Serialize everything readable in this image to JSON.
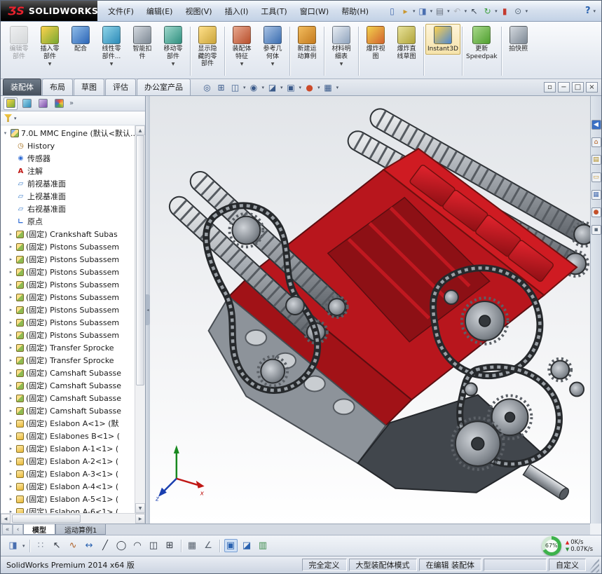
{
  "titlebar": {
    "logo_mark": "ƷS",
    "logo_text": "SOLIDWORKS",
    "menus": [
      "文件(F)",
      "编辑(E)",
      "视图(V)",
      "插入(I)",
      "工具(T)",
      "窗口(W)",
      "帮助(H)"
    ],
    "help_label": "?",
    "quick_icons": [
      {
        "name": "new-document-icon",
        "glyph": "▯",
        "color": "#4a6fb0"
      },
      {
        "name": "open-icon",
        "glyph": "▸",
        "color": "#c9972f",
        "caret": true
      },
      {
        "name": "save-icon",
        "glyph": "◨",
        "color": "#4a6fb0",
        "caret": true
      },
      {
        "name": "print-icon",
        "glyph": "▤",
        "color": "#6d7683",
        "caret": true
      },
      {
        "name": "undo-icon",
        "glyph": "↶",
        "color": "#6d7683",
        "caret": true,
        "disabled": true
      },
      {
        "name": "select-icon",
        "glyph": "↖",
        "color": "#3a4552"
      },
      {
        "name": "rebuild-icon",
        "glyph": "↻",
        "color": "#3da03d",
        "caret": true
      },
      {
        "name": "file-properties-icon",
        "glyph": "▮",
        "color": "#c43a2f"
      },
      {
        "name": "options-icon",
        "glyph": "⊙",
        "color": "#5a6a7a",
        "caret": true
      }
    ]
  },
  "ribbon": {
    "buttons": [
      {
        "name": "edit-component",
        "label": "编辑零\n部件",
        "colors": [
          "#dfe3df",
          "#9fb89f"
        ],
        "disabled": true
      },
      {
        "name": "insert-components",
        "label": "插入零\n部件",
        "colors": [
          "#ffd24d",
          "#76a832"
        ],
        "dropdown": true
      },
      {
        "name": "mate",
        "label": "配合",
        "colors": [
          "#8fbce8",
          "#2c66b8"
        ]
      },
      {
        "name": "linear-component-pattern",
        "label": "线性零\n部件...",
        "colors": [
          "#8fd4e8",
          "#2c8ab8"
        ],
        "dropdown": true
      },
      {
        "name": "smart-fasteners",
        "label": "智能扣\n件",
        "colors": [
          "#d4d9df",
          "#7d8894"
        ]
      },
      {
        "name": "move-component",
        "label": "移动零\n部件",
        "colors": [
          "#9fd8cc",
          "#2f8f7f"
        ],
        "dropdown": true,
        "sep_after": true
      },
      {
        "name": "show-hidden-components",
        "label": "显示隐\n藏的零\n部件",
        "colors": [
          "#ffe08a",
          "#caa43a"
        ],
        "sep_after": true
      },
      {
        "name": "assembly-features",
        "label": "装配体\n特征",
        "colors": [
          "#e8a88f",
          "#b84f2c"
        ],
        "dropdown": true
      },
      {
        "name": "reference-geometry",
        "label": "参考几\n何体",
        "colors": [
          "#a8c2e4",
          "#3a6db0"
        ],
        "dropdown": true,
        "sep_after": true
      },
      {
        "name": "new-motion-study",
        "label": "新建运\n动算例",
        "colors": [
          "#f2bc5d",
          "#c47a1e"
        ],
        "sep_after": true
      },
      {
        "name": "bill-of-materials",
        "label": "材料明\n细表",
        "colors": [
          "#e8edf3",
          "#8fa3bd"
        ],
        "dropdown": true,
        "sep_after": true
      },
      {
        "name": "exploded-view",
        "label": "爆炸视\n图",
        "colors": [
          "#f2d24d",
          "#d2622e"
        ]
      },
      {
        "name": "explode-line-sketch",
        "label": "爆炸直\n线草图",
        "colors": [
          "#e8e29a",
          "#b0a43a"
        ],
        "sep_after": true
      },
      {
        "name": "instant3d",
        "label": "Instant3D",
        "colors": [
          "#ffd24d",
          "#4d88d2"
        ],
        "pressed": true,
        "sep_after": true
      },
      {
        "name": "update-speedpak",
        "label": "更新\nSpeedpak",
        "colors": [
          "#a8d88a",
          "#4f9f2f"
        ],
        "sep_after": true
      },
      {
        "name": "take-snapshot",
        "label": "拍快照",
        "colors": [
          "#d4d9df",
          "#7d8894"
        ]
      }
    ]
  },
  "tabs": {
    "active": 0,
    "items": [
      "装配体",
      "布局",
      "草图",
      "评估",
      "办公室产品"
    ]
  },
  "view_toolbar": [
    {
      "name": "zoom-fit-icon",
      "glyph": "◎"
    },
    {
      "name": "zoom-area-icon",
      "glyph": "⊞"
    },
    {
      "name": "section-view-icon",
      "glyph": "◫",
      "caret": true
    },
    {
      "name": "hide-show-items-icon",
      "glyph": "◉",
      "caret": true
    },
    {
      "name": "display-style-icon",
      "glyph": "◪",
      "caret": true
    },
    {
      "name": "view-orientation-icon",
      "glyph": "▣",
      "caret": true
    },
    {
      "name": "appearances-icon",
      "glyph": "●",
      "color": "#cc4a2a",
      "caret": true
    },
    {
      "name": "scene-icon",
      "glyph": "▦",
      "caret": true
    }
  ],
  "window_buttons": [
    {
      "name": "dock-icon",
      "glyph": "▫"
    },
    {
      "name": "minimize-icon",
      "glyph": "−"
    },
    {
      "name": "restore-icon",
      "glyph": "□"
    },
    {
      "name": "close-icon",
      "glyph": "×"
    }
  ],
  "panel_tabs": [
    {
      "name": "featuremanager-tab",
      "active": true
    },
    {
      "name": "propertymanager-tab"
    },
    {
      "name": "configurationmanager-tab"
    },
    {
      "name": "displaymanager-tab"
    }
  ],
  "panel_chevron": "»",
  "tree": {
    "root": "7.0L MMC Engine (默认<默认...",
    "items": [
      {
        "icon": "history-icon",
        "label": "History"
      },
      {
        "icon": "sensors-icon",
        "label": "传感器"
      },
      {
        "icon": "annotations-icon",
        "label": "注解"
      },
      {
        "icon": "plane-icon",
        "label": "前视基准面"
      },
      {
        "icon": "plane-icon",
        "label": "上视基准面"
      },
      {
        "icon": "plane-icon",
        "label": "右视基准面"
      },
      {
        "icon": "origin-icon",
        "label": "原点"
      },
      {
        "icon": "component-icon",
        "label": "(固定) Crankshaft Subas",
        "expand": true
      },
      {
        "icon": "component-icon",
        "label": "(固定) Pistons Subassem",
        "expand": true
      },
      {
        "icon": "component-icon",
        "label": "(固定) Pistons Subassem",
        "expand": true
      },
      {
        "icon": "component-icon",
        "label": "(固定) Pistons Subassem",
        "expand": true
      },
      {
        "icon": "component-icon",
        "label": "(固定) Pistons Subassem",
        "expand": true
      },
      {
        "icon": "component-icon",
        "label": "(固定) Pistons Subassem",
        "expand": true
      },
      {
        "icon": "component-icon",
        "label": "(固定) Pistons Subassem",
        "expand": true
      },
      {
        "icon": "component-icon",
        "label": "(固定) Pistons Subassem",
        "expand": true
      },
      {
        "icon": "component-icon",
        "label": "(固定) Pistons Subassem",
        "expand": true
      },
      {
        "icon": "component-icon",
        "label": "(固定) Transfer Sprocke",
        "expand": true
      },
      {
        "icon": "component-icon",
        "label": "(固定) Transfer Sprocke",
        "expand": true
      },
      {
        "icon": "component-icon",
        "label": "(固定) Camshaft Subasse",
        "expand": true
      },
      {
        "icon": "component-icon",
        "label": "(固定) Camshaft Subasse",
        "expand": true
      },
      {
        "icon": "component-icon",
        "label": "(固定) Camshaft Subasse",
        "expand": true
      },
      {
        "icon": "component-icon",
        "label": "(固定) Camshaft Subasse",
        "expand": true
      },
      {
        "icon": "part-icon",
        "label": "(固定) Eslabon A<1> (默",
        "expand": true
      },
      {
        "icon": "part-icon",
        "label": "(固定) Eslabones B<1> (",
        "expand": true
      },
      {
        "icon": "part-icon",
        "label": "(固定) Eslabon A-1<1> (",
        "expand": true
      },
      {
        "icon": "part-icon",
        "label": "(固定) Eslabon A-2<1> (",
        "expand": true
      },
      {
        "icon": "part-icon",
        "label": "(固定) Eslabon A-3<1> (",
        "expand": true
      },
      {
        "icon": "part-icon",
        "label": "(固定) Eslabon A-4<1> (",
        "expand": true
      },
      {
        "icon": "part-icon",
        "label": "(固定) Eslabon A-5<1> (",
        "expand": true
      },
      {
        "icon": "part-icon",
        "label": "(固定) Eslabon A-6<1> (",
        "expand": true
      }
    ]
  },
  "task_pane": [
    {
      "name": "collapse-task-pane-icon",
      "glyph": "◀",
      "bg": "#3a6fc4",
      "fg": "#ffffff"
    },
    {
      "name": "solidworks-resources-icon",
      "glyph": "⌂",
      "bg": "#eef1f5",
      "fg": "#b05a1a"
    },
    {
      "name": "design-library-icon",
      "glyph": "▤",
      "bg": "#eef1f5",
      "fg": "#b08a1a"
    },
    {
      "name": "file-explorer-icon",
      "glyph": "▭",
      "bg": "#eef1f5",
      "fg": "#c9972f"
    },
    {
      "name": "view-palette-icon",
      "glyph": "▦",
      "bg": "#eef1f5",
      "fg": "#4a6fb0"
    },
    {
      "name": "appearances-scenes-icon",
      "glyph": "●",
      "bg": "#eef1f5",
      "fg": "#c4502a"
    },
    {
      "name": "custom-properties-icon",
      "glyph": "▪",
      "bg": "#eef1f5",
      "fg": "#5a6a7a"
    }
  ],
  "bottom_tabs": {
    "nav": [
      "«",
      "‹"
    ],
    "items": [
      {
        "label": "模型",
        "active": true
      },
      {
        "label": "运动算例1"
      }
    ]
  },
  "bottom_toolbar": [
    {
      "name": "save-toolbar-icon",
      "glyph": "◨",
      "color": "#4a6fb0",
      "caret": true
    },
    {
      "sep": true
    },
    {
      "name": "grip-icon",
      "glyph": "∷",
      "color": "#8a93a0"
    },
    {
      "name": "select-arrow-icon",
      "glyph": "↖",
      "color": "#2f3640"
    },
    {
      "name": "sketch-icon",
      "glyph": "∿",
      "color": "#b0622a"
    },
    {
      "name": "smart-dimension-icon",
      "glyph": "↔",
      "color": "#2a62b0"
    },
    {
      "name": "line-icon",
      "glyph": "╱",
      "color": "#2f3640"
    },
    {
      "name": "circle-icon",
      "glyph": "◯",
      "color": "#2f3640"
    },
    {
      "name": "arc-icon",
      "glyph": "◠",
      "color": "#2f3640"
    },
    {
      "name": "mirror-icon",
      "glyph": "◫",
      "color": "#2f3640"
    },
    {
      "name": "linear-pattern-icon",
      "glyph": "⊞",
      "color": "#2f3640"
    },
    {
      "sep": true
    },
    {
      "name": "grid-icon",
      "glyph": "▦",
      "color": "#5a6470"
    },
    {
      "name": "angle-snap-icon",
      "glyph": "∠",
      "color": "#5a6470"
    },
    {
      "sep": true
    },
    {
      "name": "shaded-view-icon",
      "glyph": "▣",
      "color": "#2a62b0",
      "pressed": true
    },
    {
      "name": "section-view-icon",
      "glyph": "◪",
      "color": "#2a62b0"
    },
    {
      "name": "motion-chart-icon",
      "glyph": "▥",
      "color": "#3a8a4a"
    }
  ],
  "performance": {
    "percent": "67%",
    "up_label": "0K/s",
    "down_label": "0.07K/s"
  },
  "triad": {
    "x": "x",
    "z": "z"
  },
  "statusbar": {
    "left": "SolidWorks Premium 2014 x64 版",
    "segments": [
      "完全定义",
      "大型装配体模式",
      "在编辑 装配体",
      "",
      "自定义"
    ]
  },
  "colors": {
    "accent_red": "#b8161d",
    "steel_gray": "#8d939a",
    "perf_green": "#3db24b"
  }
}
